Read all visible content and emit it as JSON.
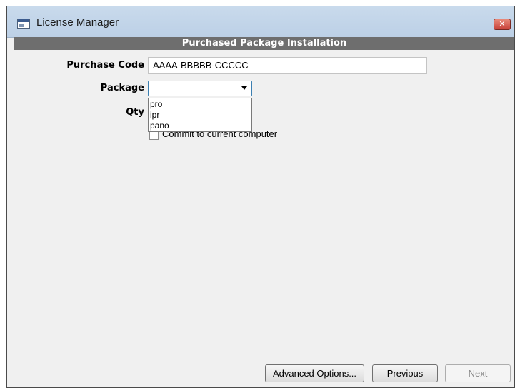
{
  "window": {
    "title": "License Manager",
    "close_glyph": "✕"
  },
  "header": {
    "title": "Purchased Package Installation"
  },
  "form": {
    "purchase_code_label": "Purchase Code",
    "purchase_code_value": "AAAA-BBBBB-CCCCC",
    "package_label": "Package",
    "package_selected": "",
    "package_options": [
      "pro",
      "ipr",
      "pano"
    ],
    "qty_label": "Qty",
    "commit_label": "Commit to current computer",
    "commit_checked": false
  },
  "footer": {
    "advanced_label": "Advanced Options...",
    "previous_label": "Previous",
    "next_label": "Next",
    "next_enabled": false
  },
  "icons": {
    "app": "license-manager-app-icon",
    "close": "close-icon",
    "dropdown": "chevron-down-icon"
  },
  "colors": {
    "titlebar": "#c9daec",
    "header_strip": "#6e6e6e",
    "close_button": "#c8423a",
    "select_focus": "#3c7fb1"
  }
}
